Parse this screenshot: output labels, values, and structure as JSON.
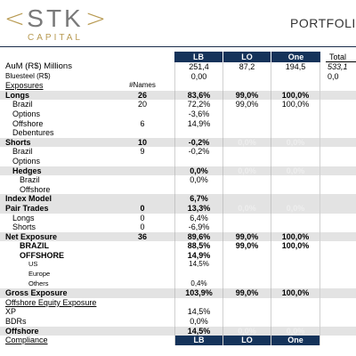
{
  "logo": {
    "left_bracket": "<",
    "name": "STK",
    "right_bracket": ">",
    "sub": "CAPITAL"
  },
  "header": {
    "title": "PORTFOLIO"
  },
  "columns": {
    "lb": "LB",
    "lo": "LO",
    "one": "One",
    "total": "Total"
  },
  "names_header": "#Names",
  "rows": [
    {
      "label": "AuM (R$) Millions",
      "names": "",
      "lb": "251,4",
      "lo": "87,2",
      "one": "194,5",
      "tot": "533,1",
      "style": "aum"
    },
    {
      "label": "Bluesteel (R$)",
      "names": "",
      "lb": "0,00",
      "lo": "",
      "one": "",
      "tot": "0,0",
      "style": "small"
    },
    {
      "label": "Exposures",
      "names": "#Names",
      "lb": "",
      "lo": "",
      "one": "",
      "tot": "",
      "style": "ul"
    },
    {
      "label": "Longs",
      "names": "26",
      "lb": "83,6%",
      "lo": "99,0%",
      "one": "100,0%",
      "tot": "",
      "style": "shade bold"
    },
    {
      "label": "Brazil",
      "names": "20",
      "lb": "72,2%",
      "lo": "99,0%",
      "one": "100,0%",
      "tot": "",
      "style": "indent1"
    },
    {
      "label": "Options",
      "names": "",
      "lb": "-3,6%",
      "lo": "",
      "one": "",
      "tot": "",
      "style": "indent1"
    },
    {
      "label": "Offshore",
      "names": "6",
      "lb": "14,9%",
      "lo": "",
      "one": "",
      "tot": "",
      "style": "indent1"
    },
    {
      "label": "Debentures",
      "names": "",
      "lb": "",
      "lo": "",
      "one": "",
      "tot": "",
      "style": "indent1"
    },
    {
      "label": "Shorts",
      "names": "10",
      "lb": "-0,2%",
      "lo": "0,0%",
      "one": "0,0%",
      "tot": "",
      "style": "shade bold faint-cols"
    },
    {
      "label": "Brazil",
      "names": "9",
      "lb": "-0,2%",
      "lo": "",
      "one": "",
      "tot": "",
      "style": "indent1"
    },
    {
      "label": "Options",
      "names": "",
      "lb": "",
      "lo": "",
      "one": "",
      "tot": "",
      "style": "indent1"
    },
    {
      "label": "Hedges",
      "names": "",
      "lb": "0,0%",
      "lo": "0,0%",
      "one": "0,0%",
      "tot": "",
      "style": "shade bold indent1 faint-cols"
    },
    {
      "label": "Brazil",
      "names": "",
      "lb": "0,0%",
      "lo": "",
      "one": "",
      "tot": "",
      "style": "indent2"
    },
    {
      "label": "Offshore",
      "names": "",
      "lb": "",
      "lo": "",
      "one": "",
      "tot": "",
      "style": "indent2"
    },
    {
      "label": "Index Model",
      "names": "",
      "lb": "6,7%",
      "lo": "",
      "one": "",
      "tot": "",
      "style": "shade bold"
    },
    {
      "label": "Pair Trades",
      "names": "0",
      "lb": "13,3%",
      "lo": "0,0%",
      "one": "0,0%",
      "tot": "",
      "style": "shade bold faint-cols"
    },
    {
      "label": "Longs",
      "names": "0",
      "lb": "6,4%",
      "lo": "",
      "one": "",
      "tot": "",
      "style": "indent1"
    },
    {
      "label": "Shorts",
      "names": "0",
      "lb": "-6,9%",
      "lo": "",
      "one": "",
      "tot": "",
      "style": "indent1"
    },
    {
      "label": "Net Exposure",
      "names": "36",
      "lb": "89,6%",
      "lo": "99,0%",
      "one": "100,0%",
      "tot": "",
      "style": "shade bold"
    },
    {
      "label": "BRAZIL",
      "names": "",
      "lb": "88,5%",
      "lo": "99,0%",
      "one": "100,0%",
      "tot": "",
      "style": "bold indent2"
    },
    {
      "label": "OFFSHORE",
      "names": "",
      "lb": "14,9%",
      "lo": "",
      "one": "",
      "tot": "",
      "style": "bold indent2"
    },
    {
      "label": "US",
      "names": "",
      "lb": "14,5%",
      "lo": "",
      "one": "",
      "tot": "",
      "style": "indent3 tiny"
    },
    {
      "label": "Europe",
      "names": "",
      "lb": "",
      "lo": "",
      "one": "",
      "tot": "",
      "style": "indent3 tiny"
    },
    {
      "label": "Others",
      "names": "",
      "lb": "0,4%",
      "lo": "",
      "one": "",
      "tot": "",
      "style": "indent3 tiny"
    },
    {
      "label": "Gross Exposure",
      "names": "",
      "lb": "103,9%",
      "lo": "99,0%",
      "one": "100,0%",
      "tot": "",
      "style": "shade bold"
    },
    {
      "label": "Offshore Equity Exposure",
      "names": "",
      "lb": "",
      "lo": "",
      "one": "",
      "tot": "",
      "style": "ul"
    },
    {
      "label": "XP",
      "names": "",
      "lb": "14,5%",
      "lo": "",
      "one": "",
      "tot": "",
      "style": ""
    },
    {
      "label": "BDRs",
      "names": "",
      "lb": "0,0%",
      "lo": "",
      "one": "",
      "tot": "",
      "style": ""
    },
    {
      "label": "Offshore",
      "names": "",
      "lb": "14,5%",
      "lo": "0,0%",
      "one": "0,0%",
      "tot": "",
      "style": "shade bold faint-cols"
    },
    {
      "label": "Compliance",
      "names": "",
      "lb": "LB",
      "lo": "LO",
      "one": "One",
      "tot": "",
      "style": "ul compliance"
    }
  ]
}
